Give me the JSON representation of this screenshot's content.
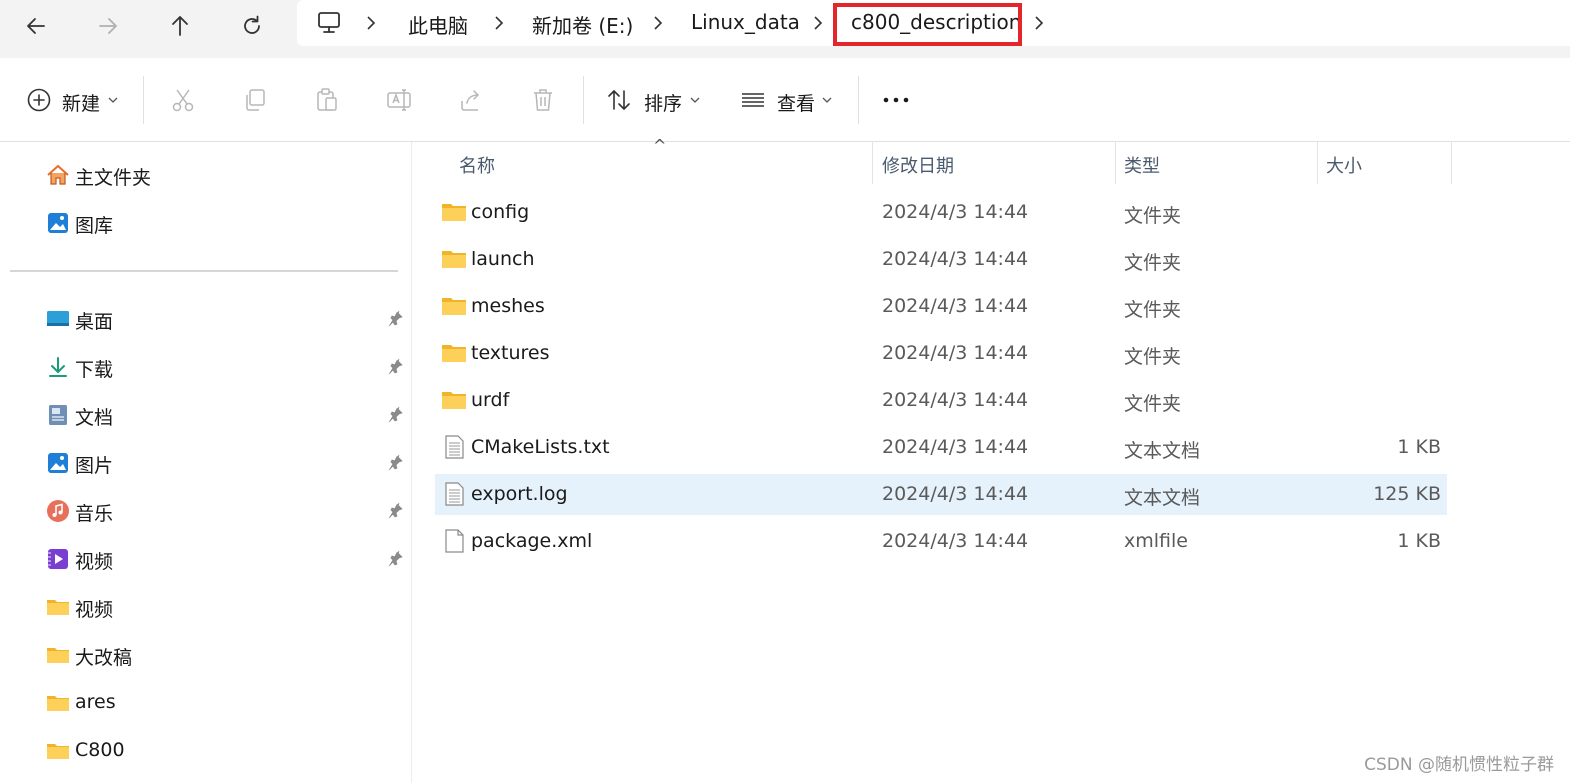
{
  "address_bar": {
    "nav_buttons": [
      "back-icon",
      "forward-icon",
      "up-icon",
      "refresh-icon"
    ],
    "breadcrumbs": [
      "此电脑",
      "新加卷 (E:)",
      "Linux_data",
      "c800_description"
    ],
    "highlight_color": "#e3262b"
  },
  "toolbar": {
    "new_label": "新建",
    "sort_label": "排序",
    "view_label": "查看",
    "more_label": "...",
    "icons": [
      "add-icon",
      "cut-icon",
      "copy-icon",
      "paste-icon",
      "rename-icon",
      "share-icon",
      "delete-icon",
      "sort-icon",
      "view-icon",
      "more-icon"
    ]
  },
  "sidebar": {
    "top_items": [
      {
        "label": "主文件夹",
        "icon": "home-icon"
      },
      {
        "label": "图库",
        "icon": "gallery-icon"
      }
    ],
    "pinned_items": [
      {
        "label": "桌面",
        "icon": "desktop-icon",
        "pinned": true
      },
      {
        "label": "下载",
        "icon": "download-icon",
        "pinned": true
      },
      {
        "label": "文档",
        "icon": "document-icon",
        "pinned": true
      },
      {
        "label": "图片",
        "icon": "pictures-icon",
        "pinned": true
      },
      {
        "label": "音乐",
        "icon": "music-icon",
        "pinned": true
      },
      {
        "label": "视频",
        "icon": "video-icon",
        "pinned": true
      },
      {
        "label": "视频",
        "icon": "folder-icon",
        "pinned": false
      },
      {
        "label": "大改稿",
        "icon": "folder-icon",
        "pinned": false
      },
      {
        "label": "ares",
        "icon": "folder-icon",
        "pinned": false
      },
      {
        "label": "C800",
        "icon": "folder-icon",
        "pinned": false
      }
    ]
  },
  "filelist": {
    "columns": {
      "name": "名称",
      "date": "修改日期",
      "type": "类型",
      "size": "大小"
    },
    "sort_indicator": "^",
    "rows": [
      {
        "name": "config",
        "date": "2024/4/3 14:44",
        "type": "文件夹",
        "size": "",
        "icon": "folder-icon"
      },
      {
        "name": "launch",
        "date": "2024/4/3 14:44",
        "type": "文件夹",
        "size": "",
        "icon": "folder-icon"
      },
      {
        "name": "meshes",
        "date": "2024/4/3 14:44",
        "type": "文件夹",
        "size": "",
        "icon": "folder-icon"
      },
      {
        "name": "textures",
        "date": "2024/4/3 14:44",
        "type": "文件夹",
        "size": "",
        "icon": "folder-icon"
      },
      {
        "name": "urdf",
        "date": "2024/4/3 14:44",
        "type": "文件夹",
        "size": "",
        "icon": "folder-icon"
      },
      {
        "name": "CMakeLists.txt",
        "date": "2024/4/3 14:44",
        "type": "文本文档",
        "size": "1 KB",
        "icon": "text-file-icon"
      },
      {
        "name": "export.log",
        "date": "2024/4/3 14:44",
        "type": "文本文档",
        "size": "125 KB",
        "icon": "text-file-icon",
        "selected": true
      },
      {
        "name": "package.xml",
        "date": "2024/4/3 14:44",
        "type": "xmlfile",
        "size": "1 KB",
        "icon": "file-icon"
      }
    ],
    "selected_row_color": "#e5f1fb"
  },
  "watermark": "CSDN @随机惯性粒子群"
}
